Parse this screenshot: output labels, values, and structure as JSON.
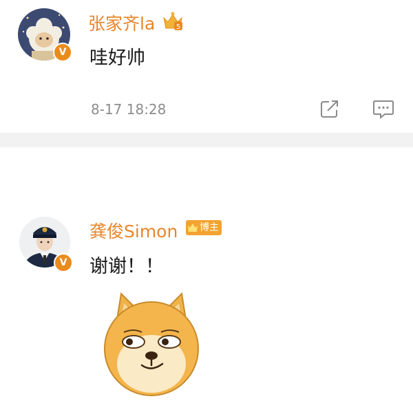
{
  "comments": [
    {
      "username": "张家齐la",
      "text": "哇好帅",
      "timestamp": "8-17 18:28",
      "verified_badge": "V",
      "avatar_icon": "sheep-avatar-icon",
      "actions": [
        "share-icon",
        "reply-comment-icon"
      ]
    },
    {
      "username": "龚俊Simon",
      "text": "谢谢！！",
      "blogger_badge": "博主",
      "verified_badge": "V",
      "avatar_icon": "police-uniform-avatar-icon",
      "sticker_icon": "doge-emoji-icon"
    }
  ],
  "colors": {
    "username": "#e8862b",
    "badge": "#e98c1c",
    "blogger_badge": "#f4a330",
    "divider": "#f2f2f2",
    "timestamp": "#8c8c8c"
  }
}
